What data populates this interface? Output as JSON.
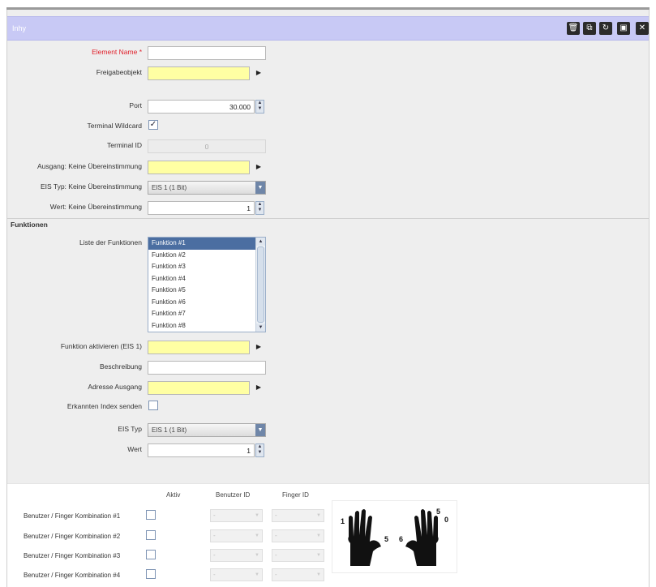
{
  "window": {
    "title": "Inhy",
    "toolbar_icons": [
      "trash-icon",
      "copy-icon",
      "refresh-icon",
      "window-icon",
      "close-icon"
    ]
  },
  "form": {
    "element_name": {
      "label": "Element Name *",
      "value": ""
    },
    "freigabeobjekt": {
      "label": "Freigabeobjekt",
      "value": ""
    },
    "port": {
      "label": "Port",
      "value": "30.000"
    },
    "terminal_wildcard": {
      "label": "Terminal Wildcard",
      "checked": true
    },
    "terminal_id": {
      "label": "Terminal ID",
      "value": "0"
    },
    "ausgang": {
      "label": "Ausgang: Keine Übereinstimmung",
      "value": ""
    },
    "eis_typ_keine": {
      "label": "EIS Typ: Keine Übereinstimmung",
      "value": "EIS 1 (1 Bit)"
    },
    "wert_keine": {
      "label": "Wert: Keine Übereinstimmung",
      "value": "1"
    }
  },
  "funktionen": {
    "section_title": "Funktionen",
    "list_label": "Liste der Funktionen",
    "items": [
      "Funktion #1",
      "Funktion #2",
      "Funktion #3",
      "Funktion #4",
      "Funktion #5",
      "Funktion #6",
      "Funktion #7",
      "Funktion #8"
    ],
    "selected_index": 0,
    "aktivieren": {
      "label": "Funktion aktivieren (EIS 1)",
      "value": ""
    },
    "beschreibung": {
      "label": "Beschreibung",
      "value": ""
    },
    "adresse_ausgang": {
      "label": "Adresse Ausgang",
      "value": ""
    },
    "erkannten_index": {
      "label": "Erkannten Index senden",
      "checked": false
    },
    "eis_typ": {
      "label": "EIS Typ",
      "value": "EIS 1 (1 Bit)"
    },
    "wert": {
      "label": "Wert",
      "value": "1"
    }
  },
  "kombinationen": {
    "headers": {
      "aktiv": "Aktiv",
      "benutzer_id": "Benutzer ID",
      "finger_id": "Finger ID"
    },
    "rows": [
      {
        "label": "Benutzer / Finger Kombination #1",
        "benutzer": "-",
        "finger": "-"
      },
      {
        "label": "Benutzer / Finger Kombination #2",
        "benutzer": "-",
        "finger": "-"
      },
      {
        "label": "Benutzer / Finger Kombination #3",
        "benutzer": "-",
        "finger": "-"
      },
      {
        "label": "Benutzer / Finger Kombination #4",
        "benutzer": "-",
        "finger": "-"
      }
    ],
    "finger_digits": {
      "left_pinky": "1",
      "left_thumb": "5",
      "right_thumb": "6",
      "right_index": "5",
      "right_pinky": "0"
    }
  }
}
